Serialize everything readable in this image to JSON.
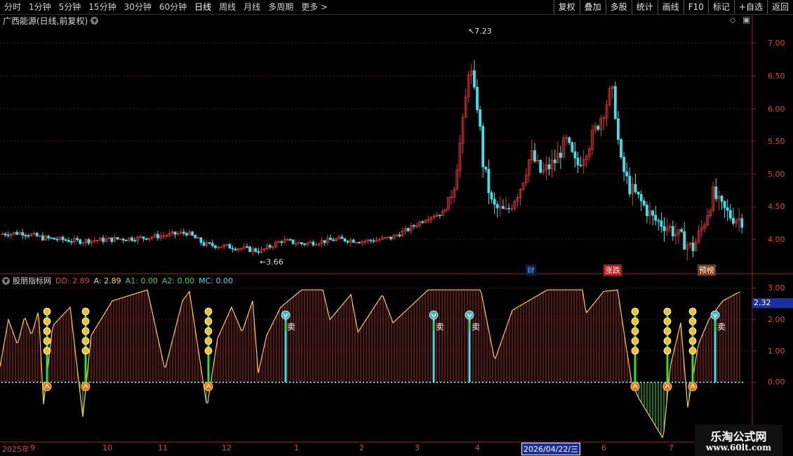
{
  "toolbar": {
    "periods": [
      "分时",
      "1分钟",
      "5分钟",
      "15分钟",
      "30分钟",
      "60分钟",
      "日线",
      "周线",
      "月线",
      "多周期",
      "更多 >"
    ],
    "active_period": "日线",
    "actions": [
      "复权",
      "叠加",
      "多股",
      "统计",
      "画线",
      "F10",
      "标记",
      "+自选",
      "返回"
    ]
  },
  "chart_title": "广西能源(日线,前复权)",
  "indicator": {
    "name": "股朋指标网",
    "dd": "DD: 2.89",
    "a": "A: 2.89",
    "a1": "A1: 0.00",
    "a2": "A2: 0.00",
    "mc": "MC: 0.00",
    "current_value": "2.32"
  },
  "price_axis": [
    "7.00",
    "6.50",
    "6.00",
    "5.50",
    "5.00",
    "4.50",
    "4.00"
  ],
  "ind_axis": [
    "3.00",
    "2.00",
    "1.00",
    "0.00"
  ],
  "annotations": {
    "high": "7.23",
    "low": "3.66"
  },
  "event_badges": [
    {
      "text": "财",
      "color": "#4aa8ff",
      "bg": "#0b1a3a"
    },
    {
      "text": "涨跌",
      "color": "#ffffff",
      "bg": "#c01818"
    },
    {
      "text": "预榜",
      "color": "#ffffff",
      "bg": "#7a3a10"
    }
  ],
  "sell_label": "卖",
  "x_axis": [
    "2025年",
    "9",
    "10",
    "11",
    "12",
    "1",
    "2",
    "3",
    "4",
    "5",
    "6",
    "7"
  ],
  "date_cursor": "2026/04/22/三",
  "watermark": {
    "line1": "乐淘公式网",
    "line2": "www.60lt.com"
  },
  "colors": {
    "up": "#e03434",
    "down": "#40e0e8",
    "ma": "#ffd040",
    "grid": "#5a1010",
    "green": "#30e030"
  }
}
